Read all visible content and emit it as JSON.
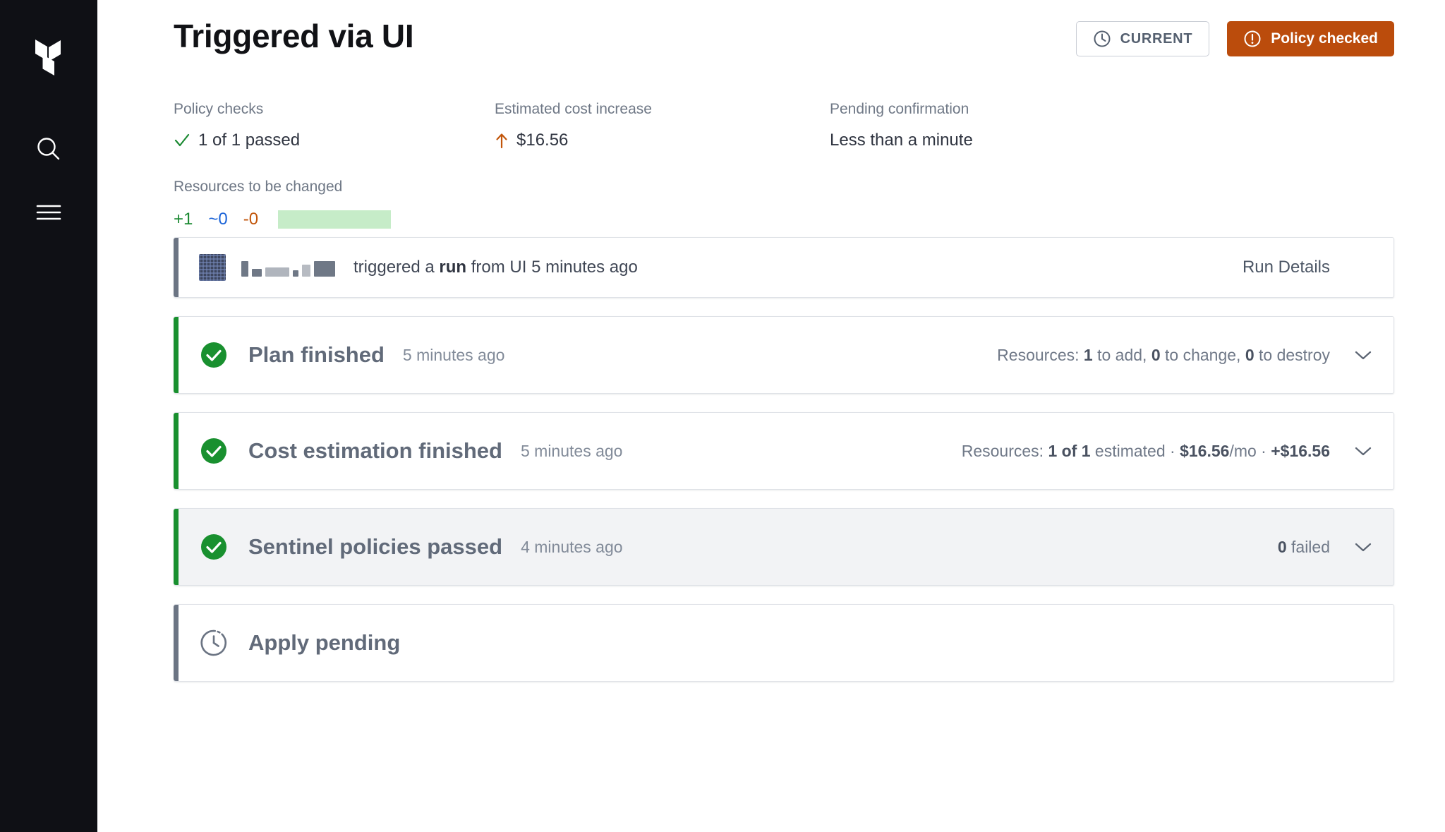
{
  "sidebar": {
    "logo_icon": "terraform-logo",
    "items": [
      {
        "icon": "search-icon",
        "name": "search"
      },
      {
        "icon": "hamburger-menu-icon",
        "name": "menu"
      }
    ]
  },
  "header": {
    "title": "Triggered via UI",
    "current_badge": {
      "label": "CURRENT",
      "icon": "clock-icon"
    },
    "policy_badge": {
      "label": "Policy checked",
      "icon": "alert-circle-icon",
      "color": "#bb4c0c"
    }
  },
  "stats": {
    "policy_checks": {
      "label": "Policy checks",
      "value": "1 of 1 passed",
      "icon": "check-icon",
      "icon_color": "#1c8a33"
    },
    "estimated_cost": {
      "label": "Estimated cost increase",
      "value": "$16.56",
      "icon": "arrow-up-icon",
      "icon_color": "#c2560b"
    },
    "pending_confirmation": {
      "label": "Pending confirmation",
      "value": "Less than a minute"
    },
    "resources_changed": {
      "label": "Resources to be changed",
      "add": "+1",
      "change": "~0",
      "destroy": "-0",
      "add_color": "#1c8a33",
      "change_color": "#1c64d8",
      "destroy_color": "#c2560b",
      "bar_color": "#c6ecc8"
    }
  },
  "timeline": {
    "trigger": {
      "actor_redacted": true,
      "text_prefix": "triggered a ",
      "text_bold": "run",
      "text_suffix": " from UI 5 minutes ago",
      "action_label": "Run Details",
      "chevron_icon": "chevron-down-icon"
    },
    "stages": [
      {
        "status_icon": "check-circle-filled-icon",
        "status_color": "#19902f",
        "accent": "green",
        "title": "Plan finished",
        "time": "5 minutes ago",
        "meta_prefix": "Resources: ",
        "meta_parts": [
          "1",
          " to add, ",
          "0",
          " to change, ",
          "0",
          " to destroy"
        ],
        "chevron_icon": "chevron-down-icon",
        "highlighted": false
      },
      {
        "status_icon": "check-circle-filled-icon",
        "status_color": "#19902f",
        "accent": "green",
        "title": "Cost estimation finished",
        "time": "5 minutes ago",
        "meta_prefix": "Resources: ",
        "meta_parts": [
          "1 of 1",
          " estimated · ",
          "$16.56",
          "/mo · ",
          "+$16.56",
          ""
        ],
        "chevron_icon": "chevron-down-icon",
        "highlighted": false
      },
      {
        "status_icon": "check-circle-filled-icon",
        "status_color": "#19902f",
        "accent": "green",
        "title": "Sentinel policies passed",
        "time": "4 minutes ago",
        "meta_prefix": "",
        "meta_parts": [
          "0",
          " failed",
          "",
          "",
          "",
          ""
        ],
        "chevron_icon": "chevron-down-icon",
        "highlighted": true
      },
      {
        "status_icon": "clock-pending-icon",
        "status_color": "#6b7483",
        "accent": "gray",
        "title": "Apply pending",
        "time": "",
        "meta_prefix": "",
        "meta_parts": [
          "",
          "",
          "",
          "",
          "",
          ""
        ],
        "chevron_icon": "",
        "highlighted": false
      }
    ]
  }
}
